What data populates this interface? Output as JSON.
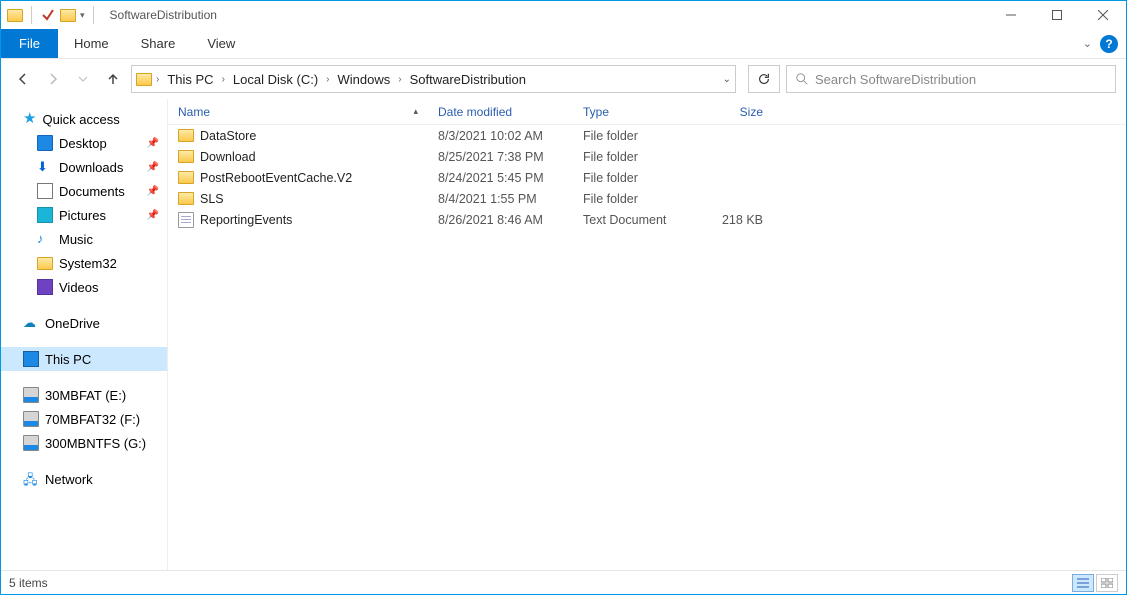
{
  "window": {
    "title": "SoftwareDistribution"
  },
  "ribbon": {
    "file_tab": "File",
    "menu": [
      "Home",
      "Share",
      "View"
    ]
  },
  "breadcrumbs": [
    "This PC",
    "Local Disk (C:)",
    "Windows",
    "SoftwareDistribution"
  ],
  "search": {
    "placeholder": "Search SoftwareDistribution"
  },
  "navpane": {
    "quick_access": "Quick access",
    "quick_items": [
      {
        "label": "Desktop",
        "icon": "desktop",
        "pinned": true
      },
      {
        "label": "Downloads",
        "icon": "downloads",
        "pinned": true
      },
      {
        "label": "Documents",
        "icon": "documents",
        "pinned": true
      },
      {
        "label": "Pictures",
        "icon": "pictures",
        "pinned": true
      },
      {
        "label": "Music",
        "icon": "music",
        "pinned": false
      },
      {
        "label": "System32",
        "icon": "folder",
        "pinned": false
      },
      {
        "label": "Videos",
        "icon": "videos",
        "pinned": false
      }
    ],
    "onedrive": "OneDrive",
    "this_pc": "This PC",
    "drives": [
      {
        "label": "30MBFAT (E:)"
      },
      {
        "label": "70MBFAT32 (F:)"
      },
      {
        "label": "300MBNTFS (G:)"
      }
    ],
    "network": "Network"
  },
  "columns": {
    "name": "Name",
    "date": "Date modified",
    "type": "Type",
    "size": "Size"
  },
  "files": [
    {
      "name": "DataStore",
      "date": "8/3/2021 10:02 AM",
      "type": "File folder",
      "size": "",
      "icon": "folder"
    },
    {
      "name": "Download",
      "date": "8/25/2021 7:38 PM",
      "type": "File folder",
      "size": "",
      "icon": "folder"
    },
    {
      "name": "PostRebootEventCache.V2",
      "date": "8/24/2021 5:45 PM",
      "type": "File folder",
      "size": "",
      "icon": "folder"
    },
    {
      "name": "SLS",
      "date": "8/4/2021 1:55 PM",
      "type": "File folder",
      "size": "",
      "icon": "folder"
    },
    {
      "name": "ReportingEvents",
      "date": "8/26/2021 8:46 AM",
      "type": "Text Document",
      "size": "218 KB",
      "icon": "doc"
    }
  ],
  "status": {
    "items": "5 items"
  }
}
